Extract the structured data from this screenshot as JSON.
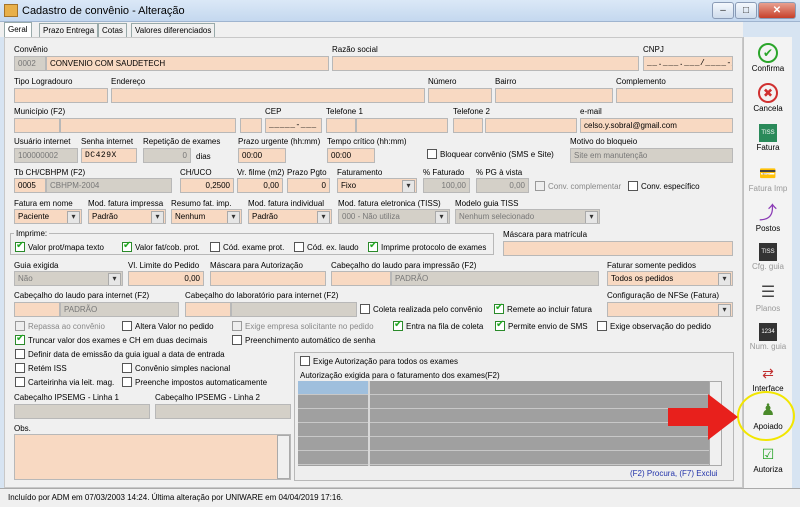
{
  "window": {
    "title": "Cadastro de convênio - Alteração"
  },
  "tabs": [
    "Geral",
    "Prazo Entrega",
    "Cotas",
    "Valores diferenciados"
  ],
  "labels": {
    "convenio": "Convênio",
    "razao": "Razão social",
    "cnpj": "CNPJ",
    "tipo_log": "Tipo Logradouro",
    "endereco": "Endereço",
    "numero": "Número",
    "bairro": "Bairro",
    "complemento": "Complemento",
    "municipio": "Município (F2)",
    "cep": "CEP",
    "tel1": "Telefone 1",
    "tel2": "Telefone 2",
    "email": "e-mail",
    "usuario": "Usuário internet",
    "senha": "Senha internet",
    "repeticao": "Repetição de exames",
    "prazo_urg": "Prazo urgente (hh:mm)",
    "tempo_crit": "Tempo crítico (hh:mm)",
    "motivo_bloq": "Motivo do bloqueio",
    "tbch": "Tb CH/CBHPM (F2)",
    "chuco": "CH/UCO",
    "vr_filme": "Vr. filme (m2)",
    "prazo_pgto": "Prazo Pgto",
    "faturamento": "Faturamento",
    "pct_faturado": "% Faturado",
    "pct_pg": "% PG à vista",
    "fatura_nome": "Fatura em nome",
    "mod_fatura_imp": "Mod. fatura impressa",
    "resumo_fat": "Resumo fat. imp.",
    "mod_fatura_ind": "Mod. fatura individual",
    "mod_fatura_elet": "Mod. fatura eletronica (TISS)",
    "modelo_guia": "Modelo guia TISS",
    "imprime": "Imprime:",
    "mascara_matricula": "Máscara para matrícula",
    "guia_exigida": "Guia exigida",
    "vl_limite": "Vl. Limite do Pedido",
    "mascara_aut": "Máscara para Autorização",
    "cab_laudo_imp": "Cabeçalho do laudo para impressão (F2)",
    "faturar_somente": "Faturar somente pedidos",
    "cab_laudo_int": "Cabeçalho do laudo para internet (F2)",
    "cab_lab_int": "Cabeçalho do laboratório para internet (F2)",
    "config_nfse": "Configuração de NFSe (Fatura)",
    "cab_ipsemg1": "Cabeçalho IPSEMG - Linha 1",
    "cab_ipsemg2": "Cabeçalho IPSEMG - Linha 2",
    "obs": "Obs.",
    "aut_exigida": "Autorização exigida para o faturamento dos exames(F2)",
    "grid_hint": "(F2) Procura, (F7) Exclui"
  },
  "values": {
    "conv_code": "0002",
    "conv_name": "CONVENIO COM SAUDETECH",
    "cnpj": "__.___.___/____-__",
    "cep": "_____-___",
    "email": "celso.y.sobral@gmail.com",
    "usuario": "100000002",
    "senha": "DC429X",
    "repeticao": "0",
    "dias": "dias",
    "prazo_urg": "00:00",
    "tempo_crit": "00:00",
    "motivo_bloq": "Site em manutenção",
    "tbch_code": "0005",
    "tbch_name": "CBHPM-2004",
    "chuco": "0,2500",
    "vr_filme": "0,00",
    "prazo_pgto": "0",
    "faturamento": "Fixo",
    "pct_faturado": "100,00",
    "pct_pg": "0,00",
    "fatura_nome": "Paciente",
    "mod_fatura_imp": "Padrão",
    "resumo_fat": "Nenhum",
    "mod_fatura_ind": "Padrão",
    "mod_fatura_elet": "000 - Não utiliza",
    "modelo_guia": "Nenhum selecionado",
    "guia_exigida": "Não",
    "vl_limite": "0,00",
    "cab_laudo_imp": "PADRÃO",
    "faturar_somente": "Todos os pedidos",
    "cab_laudo_int": "PADRÃO"
  },
  "checks": {
    "bloquear": "Bloquear convênio (SMS e Site)",
    "conv_comp": "Conv. complementar",
    "conv_esp": "Conv. específico",
    "valor_prot": "Valor prot/mapa texto",
    "valor_fat": "Valor fat/cob. prot.",
    "cod_exame": "Cód. exame prot.",
    "cod_ex_laudo": "Cód. ex. laudo",
    "imprime_prot": "Imprime protocolo de exames",
    "coleta_portal": "Coleta realizada pelo convênio",
    "remete_fatura": "Remete ao incluir fatura",
    "repassa": "Repassa ao convênio",
    "altera_valor": "Altera Valor no pedido",
    "exige_empresa": "Exige empresa solicitante no pedido",
    "entra_fila": "Entra na fila de coleta",
    "permite_sms": "Permite envio de SMS",
    "exige_obs": "Exige observação do pedido",
    "truncar": "Truncar valor dos exames e CH em duas decimais",
    "preenchimento": "Preenchimento automático de senha",
    "definir_data": "Definir data de emissão da guia igual a data de entrada",
    "retem_iss": "Retém ISS",
    "conv_simples": "Convênio simples nacional",
    "carteirinha": "Carteirinha via leit. mag.",
    "preenche_impostos": "Preenche impostos automaticamente",
    "exige_aut": "Exige Autorização para todos os exames"
  },
  "sidebar": [
    {
      "label": "Confirma",
      "icon": "check-icon"
    },
    {
      "label": "Cancela",
      "icon": "cancel-icon"
    },
    {
      "label": "Fatura",
      "icon": "tiss-icon"
    },
    {
      "label": "Fatura Imp",
      "icon": "invoice-print-icon"
    },
    {
      "label": "Postos",
      "icon": "wrench-icon"
    },
    {
      "label": "Cfg. guia",
      "icon": "guide-config-icon"
    },
    {
      "label": "Planos",
      "icon": "plans-icon"
    },
    {
      "label": "Num. guia",
      "icon": "guide-number-icon"
    },
    {
      "label": "Interface",
      "icon": "interface-icon"
    },
    {
      "label": "Apoiado",
      "icon": "person-icon"
    },
    {
      "label": "Autoriza",
      "icon": "authorize-icon"
    }
  ],
  "status": "Incluído por ADM em 07/03/2003 14:24. Última alteração por UNIWARE em 04/04/2019 17:16.",
  "colors": {
    "field_bg": "#f8d9c2",
    "highlight_circle": "#f2e600",
    "arrow": "#e8201c"
  }
}
